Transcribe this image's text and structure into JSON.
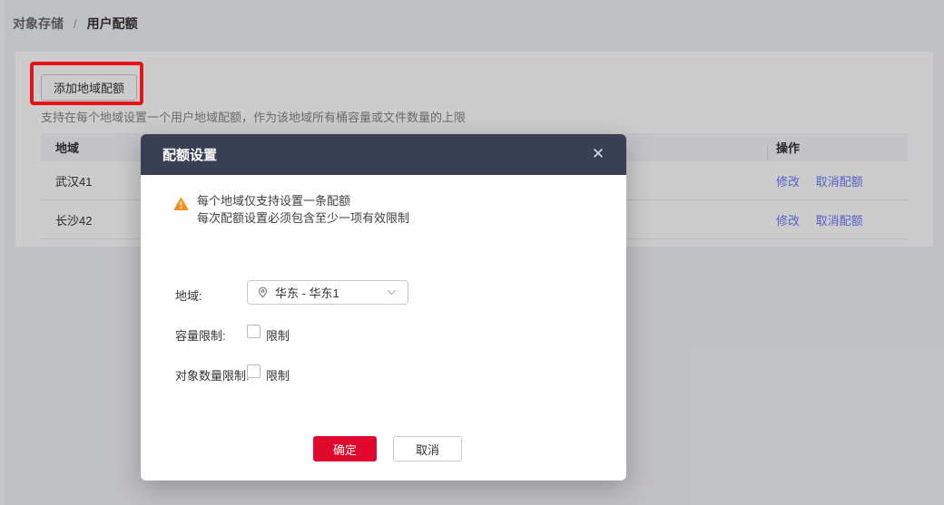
{
  "breadcrumb": {
    "parent": "对象存储",
    "separator": "/",
    "current": "用户配额"
  },
  "page": {
    "add_button": "添加地域配额",
    "description": "支持在每个地域设置一个用户地域配额，作为该地域所有桶容量或文件数量的上限",
    "table": {
      "columns": [
        "地域",
        "操作"
      ],
      "rows": [
        {
          "region": "武汉41",
          "actions": [
            "修改",
            "取消配额"
          ]
        },
        {
          "region": "长沙42",
          "actions": [
            "修改",
            "取消配额"
          ]
        }
      ]
    }
  },
  "modal": {
    "title": "配额设置",
    "close_icon": "✕",
    "warning_lines": {
      "line1": "每个地域仅支持设置一条配额",
      "line2": "每次配额设置必须包含至少一项有效限制"
    },
    "fields": {
      "region_label": "地域:",
      "region_value": "华东 - 华东1",
      "capacity_label": "容量限制:",
      "capacity_checkbox_label": "限制",
      "object_count_label": "对象数量限制:",
      "object_count_checkbox_label": "限制"
    },
    "buttons": {
      "confirm": "确定",
      "cancel": "取消"
    }
  },
  "colors": {
    "brand_red": "#e1082d",
    "annotation_red": "#e81216",
    "modal_header_navy": "#394056",
    "link_blue": "#6b78fa",
    "warning_orange": "#f78e1e",
    "page_background": "#f0f2f7",
    "table_header_bg": "#f5f6fa"
  }
}
